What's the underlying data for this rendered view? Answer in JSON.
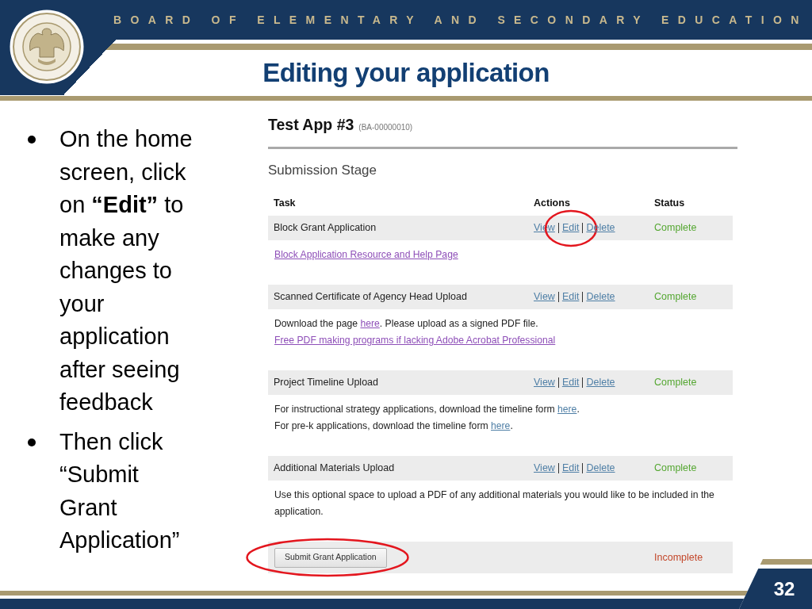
{
  "header": {
    "organization": "BOARD OF ELEMENTARY AND SECONDARY EDUCATION"
  },
  "slide": {
    "title": "Editing your application",
    "number": "32"
  },
  "bullets": [
    "On the home screen, click on **“Edit”** to make any changes to your application after seeing feedback",
    "Then click “Submit Grant Application”"
  ],
  "app_screenshot": {
    "title": "Test App #3",
    "app_id": "(BA-00000010)",
    "section": "Submission Stage",
    "columns": [
      "Task",
      "Actions",
      "Status"
    ],
    "rows": [
      {
        "kind": "task",
        "task": "Block Grant Application",
        "actions": [
          {
            "label": "View",
            "circled": false
          },
          {
            "label": "Edit",
            "circled": true
          },
          {
            "label": "Delete",
            "circled": false
          }
        ],
        "status": "Complete",
        "complete": true,
        "details": [
          [
            {
              "kind": "link",
              "text": "Block Application Resource and Help Page",
              "visited": true
            }
          ]
        ]
      },
      {
        "kind": "task",
        "task": "Scanned Certificate of Agency Head Upload",
        "actions": [
          {
            "label": "View",
            "circled": false
          },
          {
            "label": "Edit",
            "circled": false
          },
          {
            "label": "Delete",
            "circled": false
          }
        ],
        "status": "Complete",
        "complete": true,
        "details": [
          [
            {
              "kind": "text",
              "text": "Download the page "
            },
            {
              "kind": "link",
              "text": "here",
              "visited": true
            },
            {
              "kind": "text",
              "text": ". Please upload as a signed PDF file."
            }
          ],
          [
            {
              "kind": "link",
              "text": "Free PDF making programs if lacking Adobe Acrobat Professional",
              "visited": true
            }
          ]
        ]
      },
      {
        "kind": "task",
        "task": "Project Timeline Upload",
        "actions": [
          {
            "label": "View",
            "circled": false
          },
          {
            "label": "Edit",
            "circled": false
          },
          {
            "label": "Delete",
            "circled": false
          }
        ],
        "status": "Complete",
        "complete": true,
        "details": [
          [
            {
              "kind": "text",
              "text": "For instructional strategy applications, download the timeline form "
            },
            {
              "kind": "link",
              "text": "here",
              "visited": false
            },
            {
              "kind": "text",
              "text": "."
            }
          ],
          [
            {
              "kind": "text",
              "text": "For pre-k applications, download the timeline form "
            },
            {
              "kind": "link",
              "text": "here",
              "visited": false
            },
            {
              "kind": "text",
              "text": "."
            }
          ]
        ]
      },
      {
        "kind": "task",
        "task": "Additional Materials Upload",
        "actions": [
          {
            "label": "View",
            "circled": false
          },
          {
            "label": "Edit",
            "circled": false
          },
          {
            "label": "Delete",
            "circled": false
          }
        ],
        "status": "Complete",
        "complete": true,
        "details": [
          [
            {
              "kind": "text",
              "text": "Use this optional space to upload a PDF of any additional materials you would like to be included in the application."
            }
          ]
        ]
      },
      {
        "kind": "submit",
        "button": "Submit Grant Application",
        "circled": true,
        "status": "Incomplete",
        "complete": false
      }
    ]
  }
}
